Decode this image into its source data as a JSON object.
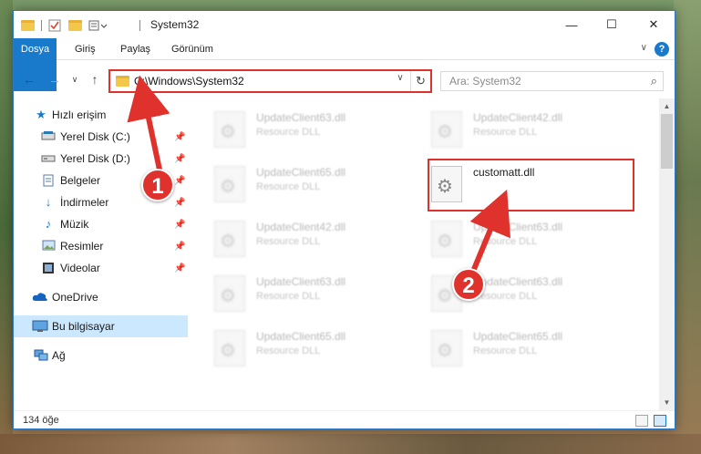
{
  "window": {
    "title": "System32",
    "controls": {
      "minimize": "—",
      "maximize": "☐",
      "close": "✕"
    }
  },
  "ribbon": {
    "tabs": [
      "Dosya",
      "Giriş",
      "Paylaş",
      "Görünüm"
    ],
    "help": "?"
  },
  "nav": {
    "back": "←",
    "forward": "→",
    "dropdown": "∨",
    "up": "↑",
    "address": "C:\\Windows\\System32",
    "refresh": "↻",
    "search_placeholder": "Ara: System32"
  },
  "sidebar": {
    "items": [
      {
        "label": "Hızlı erişim",
        "icon": "star-icon",
        "pinned": false
      },
      {
        "label": "Yerel Disk (C:)",
        "icon": "drive-icon",
        "pinned": true
      },
      {
        "label": "Yerel Disk (D:)",
        "icon": "drive-icon",
        "pinned": true
      },
      {
        "label": "Belgeler",
        "icon": "documents-icon",
        "pinned": true
      },
      {
        "label": "İndirmeler",
        "icon": "download-icon",
        "pinned": true
      },
      {
        "label": "Müzik",
        "icon": "music-icon",
        "pinned": true
      },
      {
        "label": "Resimler",
        "icon": "pictures-icon",
        "pinned": true
      },
      {
        "label": "Videolar",
        "icon": "video-icon",
        "pinned": true
      },
      {
        "label": "OneDrive",
        "icon": "cloud-icon",
        "pinned": false
      },
      {
        "label": "Bu bilgisayar",
        "icon": "computer-icon",
        "pinned": false,
        "selected": true
      },
      {
        "label": "Ağ",
        "icon": "network-icon",
        "pinned": false
      }
    ]
  },
  "files": {
    "left": [
      {
        "name": "UpdateClient63.dll",
        "type": "Resource DLL"
      },
      {
        "name": "UpdateClient65.dll",
        "type": "Resource DLL"
      },
      {
        "name": "UpdateClient42.dll",
        "type": "Resource DLL"
      },
      {
        "name": "UpdateClient63.dll",
        "type": "Resource DLL"
      },
      {
        "name": "UpdateClient65.dll",
        "type": "Resource DLL"
      }
    ],
    "right": [
      {
        "name": "UpdateClient42.dll",
        "type": "Resource DLL"
      },
      {
        "name": "customatt.dll",
        "type": ""
      },
      {
        "name": "UpdateClient63.dll",
        "type": "Resource DLL"
      },
      {
        "name": "UpdateClient63.dll",
        "type": "Resource DLL"
      },
      {
        "name": "UpdateClient65.dll",
        "type": "Resource DLL"
      }
    ]
  },
  "status": {
    "count": "134 öğe"
  },
  "annotations": {
    "step1": "1",
    "step2": "2",
    "color": "#e0322c"
  }
}
